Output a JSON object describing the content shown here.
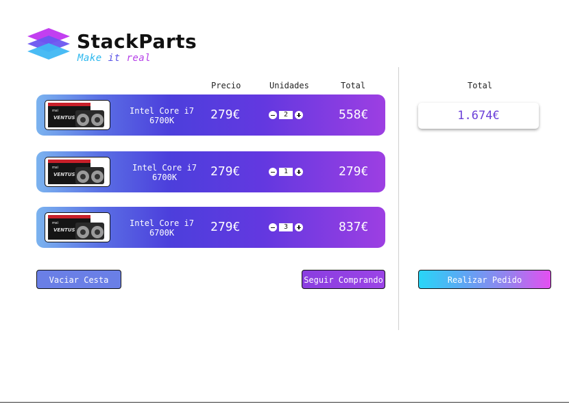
{
  "brand": {
    "name": "StackParts",
    "tagline_1": "Make",
    "tagline_2": "it",
    "tagline_3": "real"
  },
  "columns": {
    "price": "Precio",
    "units": "Unidades",
    "total": "Total"
  },
  "cart": {
    "items": [
      {
        "name_line1": "Intel Core i7",
        "name_line2": "6700K",
        "price": "279€",
        "quantity": "2",
        "line_total": "558€"
      },
      {
        "name_line1": "Intel Core i7",
        "name_line2": "6700K",
        "price": "279€",
        "quantity": "1",
        "line_total": "279€"
      },
      {
        "name_line1": "Intel Core i7",
        "name_line2": "6700K",
        "price": "279€",
        "quantity": "3",
        "line_total": "837€"
      }
    ]
  },
  "actions": {
    "empty_cart": "Vaciar Cesta",
    "continue_shopping": "Seguir Comprando",
    "place_order": "Realizar Pedido"
  },
  "summary": {
    "label": "Total",
    "amount": "1.674€"
  },
  "thumbnail": {
    "box_label": "VENTUS",
    "brand_mark": "msi"
  },
  "icons": {
    "logo": "stacked-layers-logo",
    "decrease": "minus-icon",
    "increase": "plus-icon"
  },
  "colors": {
    "accent_purple": "#9d3fe2",
    "accent_blue": "#4c3fdc",
    "accent_cyan": "#28d6f7",
    "accent_pink": "#e44ff1"
  }
}
